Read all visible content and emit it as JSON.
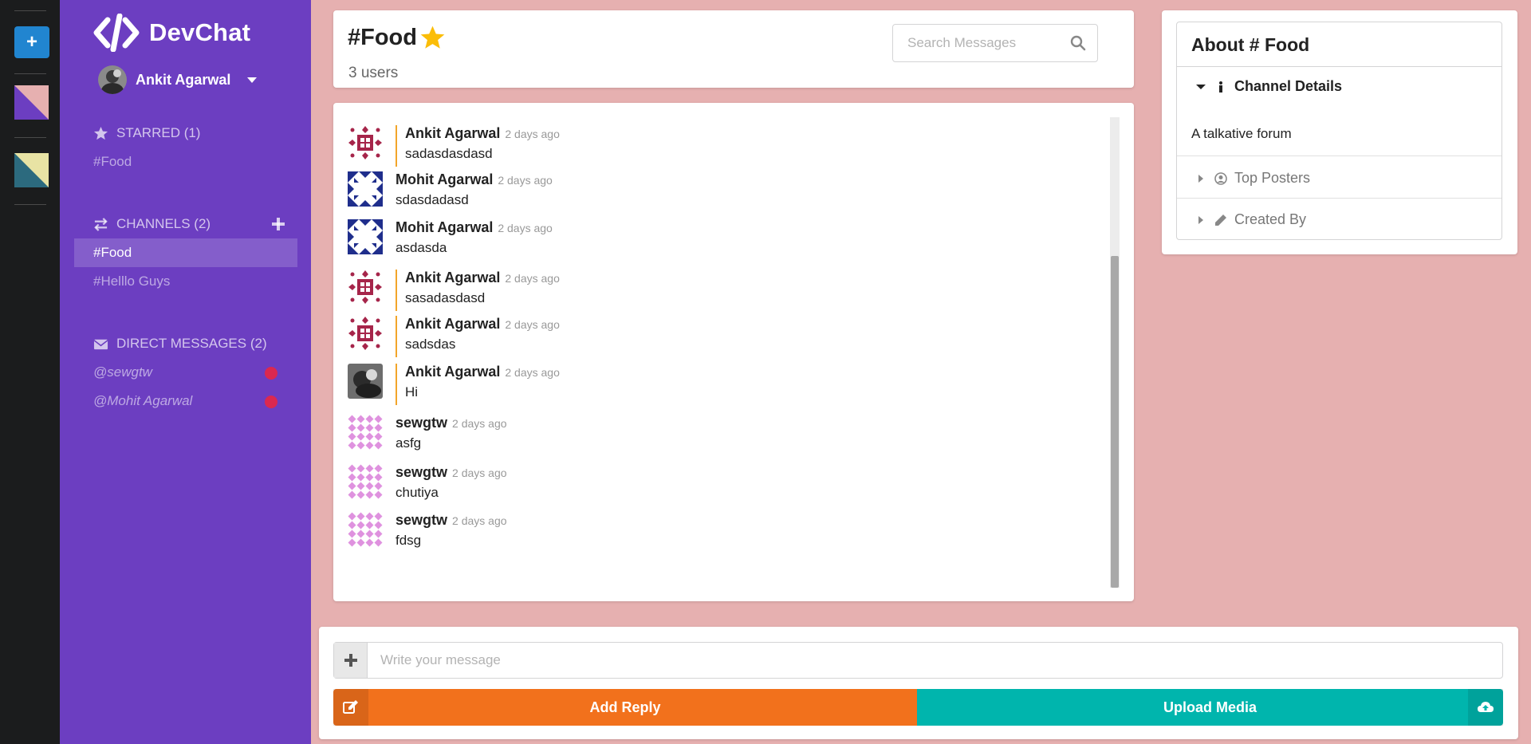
{
  "app": {
    "name": "DevChat"
  },
  "colors": {
    "rail": "#1b1c1d",
    "sidebar": "#6c3ec1",
    "background": "#e6b0b0",
    "accent_orange": "#f2711c",
    "accent_teal": "#00b5ad",
    "dm_dot": "#db2850"
  },
  "rail": {
    "add_icon": "plus-icon",
    "swatches": [
      {
        "primary": "#6c3ec1",
        "secondary": "#e6b0b0"
      },
      {
        "primary": "#2c6a7e",
        "secondary": "#e8e3a4"
      }
    ]
  },
  "sidebar": {
    "user": {
      "name": "Ankit Agarwal"
    },
    "starred": {
      "label": "STARRED (1)",
      "items": [
        "#Food"
      ]
    },
    "channels": {
      "label": "CHANNELS (2)",
      "items": [
        "#Food",
        "#Helllo Guys"
      ],
      "active": "#Food"
    },
    "direct": {
      "label": "DIRECT MESSAGES (2)",
      "items": [
        "@sewgtw",
        "@Mohit Agarwal"
      ]
    }
  },
  "header": {
    "title": "#Food",
    "users": "3 users",
    "search_placeholder": "Search Messages"
  },
  "messages": [
    {
      "author": "Ankit Agarwal",
      "time": "2 days ago",
      "text": "sadasdasdasd",
      "mine": true,
      "avatar": "identicon-maroon"
    },
    {
      "author": "Mohit Agarwal",
      "time": "2 days ago",
      "text": "sdasdadasd",
      "mine": false,
      "avatar": "identicon-navy"
    },
    {
      "author": "Mohit Agarwal",
      "time": "2 days ago",
      "text": "asdasda",
      "mine": false,
      "avatar": "identicon-navy"
    },
    {
      "author": "Ankit Agarwal",
      "time": "2 days ago",
      "text": "sasadasdasd",
      "mine": true,
      "avatar": "identicon-maroon"
    },
    {
      "author": "Ankit Agarwal",
      "time": "2 days ago",
      "text": "sadsdas",
      "mine": true,
      "avatar": "identicon-maroon"
    },
    {
      "author": "Ankit Agarwal",
      "time": "2 days ago",
      "text": "Hi",
      "mine": true,
      "avatar": "photo"
    },
    {
      "author": "sewgtw",
      "time": "2 days ago",
      "text": "asfg",
      "mine": false,
      "avatar": "identicon-pink"
    },
    {
      "author": "sewgtw",
      "time": "2 days ago",
      "text": "chutiya",
      "mine": false,
      "avatar": "identicon-pink"
    },
    {
      "author": "sewgtw",
      "time": "2 days ago",
      "text": "fdsg",
      "mine": false,
      "avatar": "identicon-pink"
    }
  ],
  "about": {
    "title": "About # Food",
    "details_label": "Channel Details",
    "description": "A talkative forum",
    "top_posters_label": "Top Posters",
    "created_by_label": "Created By"
  },
  "composer": {
    "placeholder": "Write your message",
    "reply_label": "Add Reply",
    "upload_label": "Upload Media"
  }
}
